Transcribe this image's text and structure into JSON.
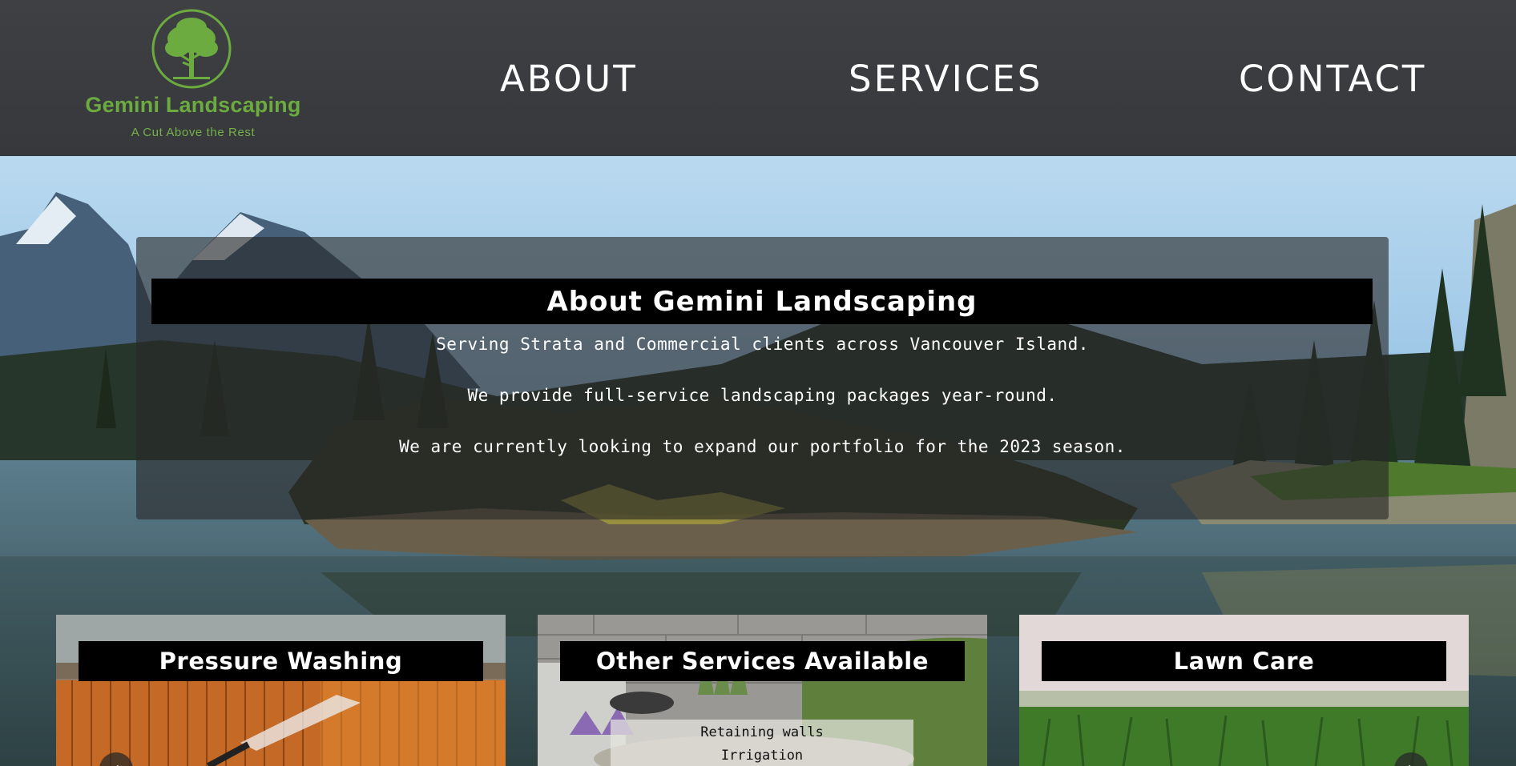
{
  "brand": {
    "name": "Gemini Landscaping",
    "tagline": "A Cut Above the Rest",
    "logo_icon": "tree-icon",
    "accent_color": "#6cab3f"
  },
  "nav": {
    "items": [
      {
        "label": "ABOUT"
      },
      {
        "label": "SERVICES"
      },
      {
        "label": "CONTACT"
      }
    ]
  },
  "about": {
    "title": "About Gemini Landscaping",
    "lines": [
      "Serving Strata and Commercial clients across Vancouver Island.",
      "We provide full-service landscaping packages year-round.",
      "We are currently looking to expand our portfolio for the 2023 season."
    ]
  },
  "services": {
    "cards": [
      {
        "title": "Pressure Washing",
        "items": []
      },
      {
        "title": "Other Services Available",
        "items": [
          "Retaining walls",
          "Irrigation"
        ]
      },
      {
        "title": "Lawn Care",
        "items": []
      }
    ],
    "arrow_icons": [
      "chevron-left-icon",
      "chevron-right-icon"
    ]
  }
}
